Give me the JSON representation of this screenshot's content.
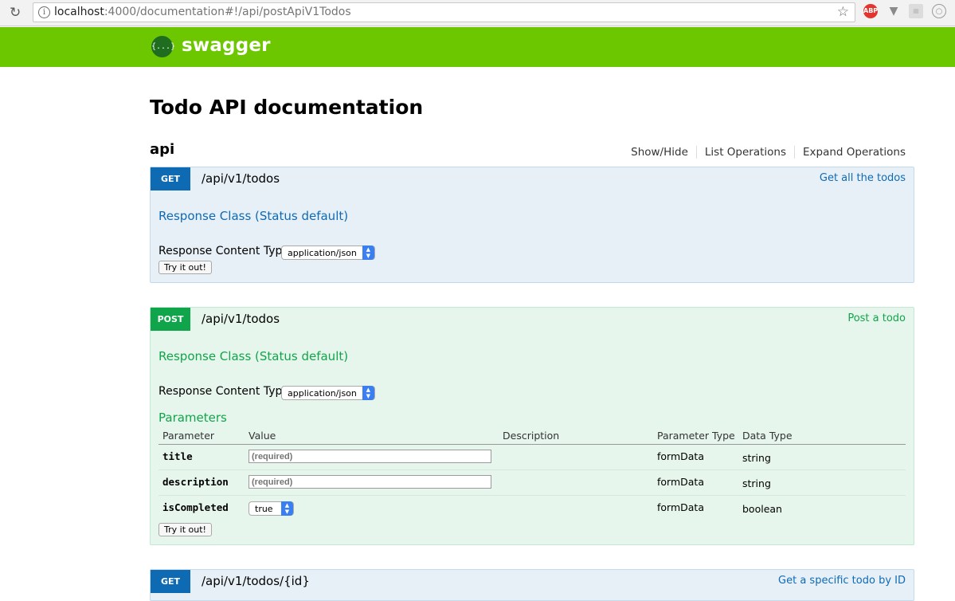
{
  "browser": {
    "url_host": "localhost",
    "url_path": ":4000/documentation#!/api/postApiV1Todos",
    "ext_abp": "ABP"
  },
  "header": {
    "logo_text": "{...}",
    "brand": "swagger"
  },
  "page": {
    "title": "Todo API documentation"
  },
  "resource": {
    "name": "api",
    "actions": [
      "Show/Hide",
      "List Operations",
      "Expand Operations"
    ]
  },
  "operations": [
    {
      "method": "GET",
      "path": "/api/v1/todos",
      "summary": "Get all the todos",
      "response_class": "Response Class (Status default)",
      "content_type_label": "Response Content Type",
      "content_type": "application/json",
      "try_label": "Try it out!"
    },
    {
      "method": "POST",
      "path": "/api/v1/todos",
      "summary": "Post a todo",
      "response_class": "Response Class (Status default)",
      "content_type_label": "Response Content Type",
      "content_type": "application/json",
      "parameters_title": "Parameters",
      "param_headers": [
        "Parameter",
        "Value",
        "Description",
        "Parameter Type",
        "Data Type"
      ],
      "params": [
        {
          "name": "title",
          "placeholder": "(required)",
          "param_type": "formData",
          "data_type": "string"
        },
        {
          "name": "description",
          "placeholder": "(required)",
          "param_type": "formData",
          "data_type": "string"
        },
        {
          "name": "isCompleted",
          "select_value": "true",
          "param_type": "formData",
          "data_type": "boolean"
        }
      ],
      "try_label": "Try it out!"
    },
    {
      "method": "GET",
      "path": "/api/v1/todos/{id}",
      "summary": "Get a specific todo by ID"
    }
  ],
  "colors": {
    "swagger_green": "#6cc700",
    "get_blue": "#0f6ab4",
    "post_green": "#10a54a"
  }
}
